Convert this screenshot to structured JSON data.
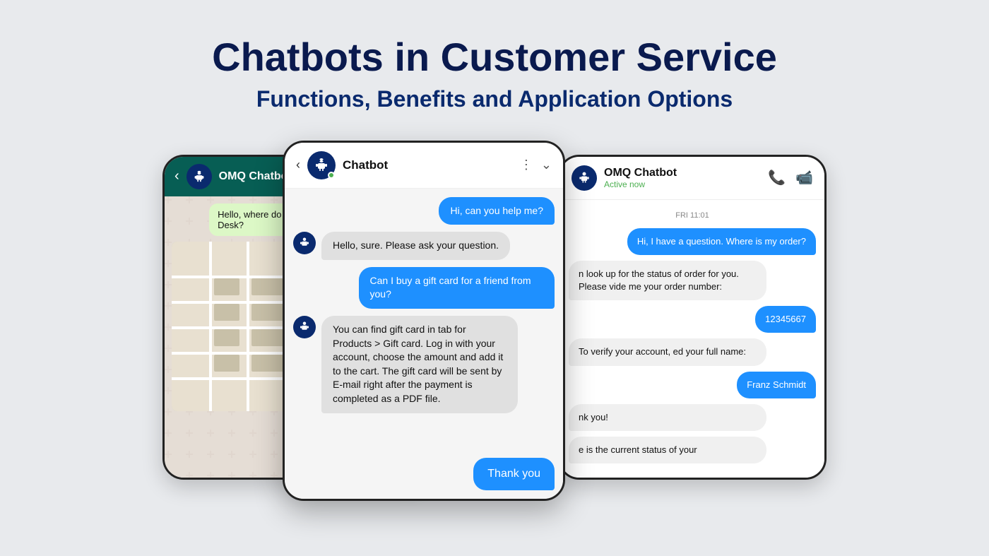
{
  "header": {
    "title": "Chatbots in Customer Service",
    "subtitle": "Functions, Benefits and Application Options"
  },
  "phone_left": {
    "chat_name": "OMQ Chatbot",
    "message1": "Hello, where do I find the Customer Service Desk?"
  },
  "phone_center": {
    "chat_name": "Chatbot",
    "msg1": "Hi, can you help me?",
    "msg2": "Hello, sure. Please ask your question.",
    "msg3": "Can I buy a gift card for a friend from you?",
    "msg4": "You can find gift card in tab for Products > Gift card. Log in with your account, choose the amount and add it to the cart. The gift card will be sent by E-mail right after the payment is completed as a PDF file.",
    "thank_you": "Thank you"
  },
  "phone_right": {
    "chat_name": "OMQ Chatbot",
    "status": "Active now",
    "date_label": "FRI 11:01",
    "msg1": "Hi, I have a question. Where is my order?",
    "msg2": "n look up for the status of order for you. Please vide me your order number:",
    "msg3": "12345667",
    "msg4": "To verify your account, ed your full name:",
    "msg5": "Franz Schmidt",
    "msg6": "nk you!",
    "msg7": "e is the current status of your"
  },
  "icons": {
    "back": "‹",
    "menu": "⋮",
    "chevron_down": "∨",
    "robot": "🤖",
    "phone": "📞",
    "video": "📹"
  }
}
